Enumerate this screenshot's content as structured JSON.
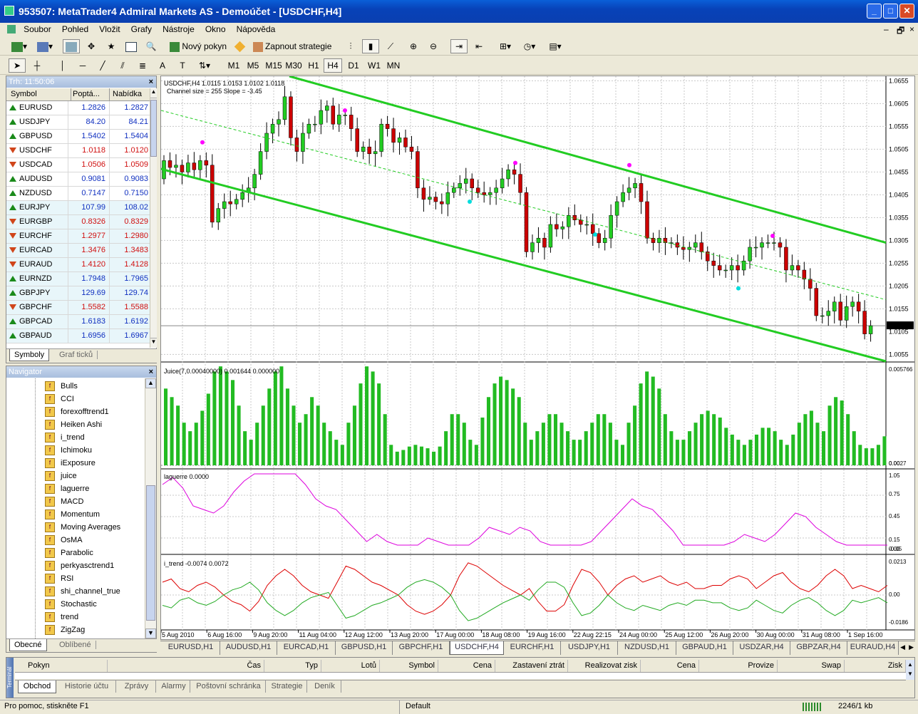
{
  "window": {
    "title": "953507: MetaTrader4 Admiral Markets AS - Demoúčet - [USDCHF,H4]",
    "min": "_",
    "max": "□",
    "close": "✕"
  },
  "menu": [
    "Soubor",
    "Pohled",
    "Vložit",
    "Grafy",
    "Nástroje",
    "Okno",
    "Nápověda"
  ],
  "menu_right": [
    "–",
    "🗗",
    "×"
  ],
  "toolbar": {
    "new_order": "Nový pokyn",
    "experts": "Zapnout strategie",
    "timeframes": [
      "M1",
      "M5",
      "M15",
      "M30",
      "H1",
      "H4",
      "D1",
      "W1",
      "MN"
    ],
    "active_tf": "H4"
  },
  "market_watch": {
    "header": "Trh: 11:50:06",
    "col_symbol": "Symbol",
    "col_bid": "Poptá...",
    "col_ask": "Nabídka",
    "rows": [
      {
        "s": "EURUSD",
        "b": "1.2826",
        "a": "1.2827",
        "d": "up"
      },
      {
        "s": "USDJPY",
        "b": "84.20",
        "a": "84.21",
        "d": "up"
      },
      {
        "s": "GBPUSD",
        "b": "1.5402",
        "a": "1.5404",
        "d": "up"
      },
      {
        "s": "USDCHF",
        "b": "1.0118",
        "a": "1.0120",
        "d": "dn"
      },
      {
        "s": "USDCAD",
        "b": "1.0506",
        "a": "1.0509",
        "d": "dn"
      },
      {
        "s": "AUDUSD",
        "b": "0.9081",
        "a": "0.9083",
        "d": "up"
      },
      {
        "s": "NZDUSD",
        "b": "0.7147",
        "a": "0.7150",
        "d": "up"
      },
      {
        "s": "EURJPY",
        "b": "107.99",
        "a": "108.02",
        "d": "up"
      },
      {
        "s": "EURGBP",
        "b": "0.8326",
        "a": "0.8329",
        "d": "dn"
      },
      {
        "s": "EURCHF",
        "b": "1.2977",
        "a": "1.2980",
        "d": "dn"
      },
      {
        "s": "EURCAD",
        "b": "1.3476",
        "a": "1.3483",
        "d": "dn"
      },
      {
        "s": "EURAUD",
        "b": "1.4120",
        "a": "1.4128",
        "d": "dn"
      },
      {
        "s": "EURNZD",
        "b": "1.7948",
        "a": "1.7965",
        "d": "up"
      },
      {
        "s": "GBPJPY",
        "b": "129.69",
        "a": "129.74",
        "d": "up"
      },
      {
        "s": "GBPCHF",
        "b": "1.5582",
        "a": "1.5588",
        "d": "dn"
      },
      {
        "s": "GBPCAD",
        "b": "1.6183",
        "a": "1.6192",
        "d": "up"
      },
      {
        "s": "GBPAUD",
        "b": "1.6956",
        "a": "1.6967",
        "d": "up"
      }
    ],
    "tabs": [
      "Symboly",
      "Graf ticků"
    ]
  },
  "navigator": {
    "header": "Navigator",
    "items": [
      "Bulls",
      "CCI",
      "forexofftrend1",
      "Heiken Ashi",
      "i_trend",
      "Ichimoku",
      "iExposure",
      "juice",
      "laguerre",
      "MACD",
      "Momentum",
      "Moving Averages",
      "OsMA",
      "Parabolic",
      "perkyasctrend1",
      "RSI",
      "shi_channel_true",
      "Stochastic",
      "trend",
      "ZigZag"
    ],
    "tabs": [
      "Obecné",
      "Oblíbené"
    ]
  },
  "chart": {
    "info": "USDCHF,H4  1.0115 1.0153 1.0102 1.0118",
    "channel": "Channel size = 255  Slope = -3.45",
    "price_labels": [
      "1.0655",
      "1.0605",
      "1.0555",
      "1.0505",
      "1.0455",
      "1.0405",
      "1.0355",
      "1.0305",
      "1.0255",
      "1.0205",
      "1.0155",
      "1.0118",
      "1.0105",
      "1.0055"
    ],
    "juice_label": "Juice(7,0.00040000) 0.001644 0.000000",
    "juice_scale": [
      "0.005766",
      "0.00",
      "0.0027"
    ],
    "laguerre_label": "laguerre 0.0000",
    "laguerre_scale": [
      "1.05",
      "0.75",
      "0.45",
      "0.15",
      "0.00",
      "-0.05"
    ],
    "itrend_label": "i_trend -0.0074 0.0072",
    "itrend_scale": [
      "0.0213",
      "0.00",
      "-0.0186"
    ],
    "time_labels": [
      "5 Aug 2010",
      "6 Aug 16:00",
      "9 Aug 20:00",
      "11 Aug 04:00",
      "12 Aug 12:00",
      "13 Aug 20:00",
      "17 Aug 00:00",
      "18 Aug 08:00",
      "19 Aug 16:00",
      "22 Aug 22:15",
      "24 Aug 00:00",
      "25 Aug 12:00",
      "26 Aug 20:00",
      "30 Aug 00:00",
      "31 Aug 08:00",
      "1 Sep 16:00"
    ]
  },
  "chart_tabs": [
    "EURUSD,H1",
    "AUDUSD,H1",
    "EURCAD,H1",
    "GBPUSD,H1",
    "GBPCHF,H1",
    "USDCHF,H4",
    "EURCHF,H1",
    "USDJPY,H1",
    "NZDUSD,H1",
    "GBPAUD,H1",
    "USDZAR,H4",
    "GBPZAR,H4",
    "EURAUD,H4"
  ],
  "terminal": {
    "cols": [
      "Pokyn",
      "Čas",
      "Typ",
      "Lotů",
      "Symbol",
      "Cena",
      "Zastavení ztrát",
      "Realizovat zisk",
      "Cena",
      "Provize",
      "Swap",
      "Zisk"
    ],
    "tabs": [
      "Obchod",
      "Historie účtu",
      "Zprávy",
      "Alarmy",
      "Poštovní schránka",
      "Strategie",
      "Deník"
    ],
    "side": "Terminál"
  },
  "status": {
    "help": "Pro pomoc, stiskněte F1",
    "profile": "Default",
    "traffic": "2246/1 kb"
  }
}
